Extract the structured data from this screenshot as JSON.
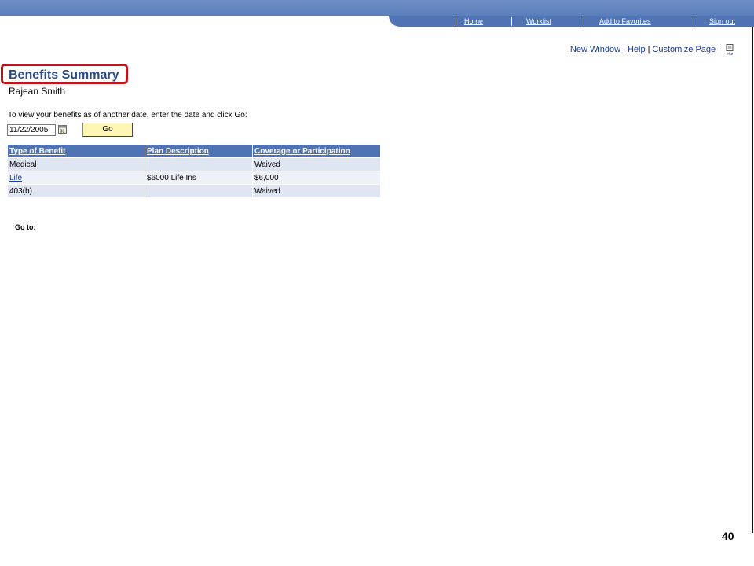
{
  "nav": {
    "home": "Home",
    "worklist": "Worklist",
    "favorites": "Add to Favorites",
    "signout": "Sign out"
  },
  "utility": {
    "new_window": "New Window",
    "help": "Help",
    "customize": "Customize Page",
    "sep": "|"
  },
  "page": {
    "title": "Benefits Summary",
    "person": "Rajean Smith",
    "instruction": "To view your benefits as of another date, enter the date and click Go:",
    "date_value": "11/22/2005",
    "go_label": "Go",
    "goto_label": "Go to:",
    "page_number": "40"
  },
  "table": {
    "headers": [
      "Type of Benefit",
      "Plan Description",
      "Coverage or Participation"
    ],
    "rows": [
      [
        "Medical",
        "",
        "Waived"
      ],
      [
        "Life",
        "$6000 Life Ins",
        "$6,000"
      ],
      [
        "403(b)",
        "",
        "Waived"
      ]
    ]
  },
  "colors": {
    "header_blue": "#4f73b3",
    "title_blue": "#2c4a86",
    "highlight_red": "#c0131b",
    "go_button": "#fdf7b3"
  }
}
